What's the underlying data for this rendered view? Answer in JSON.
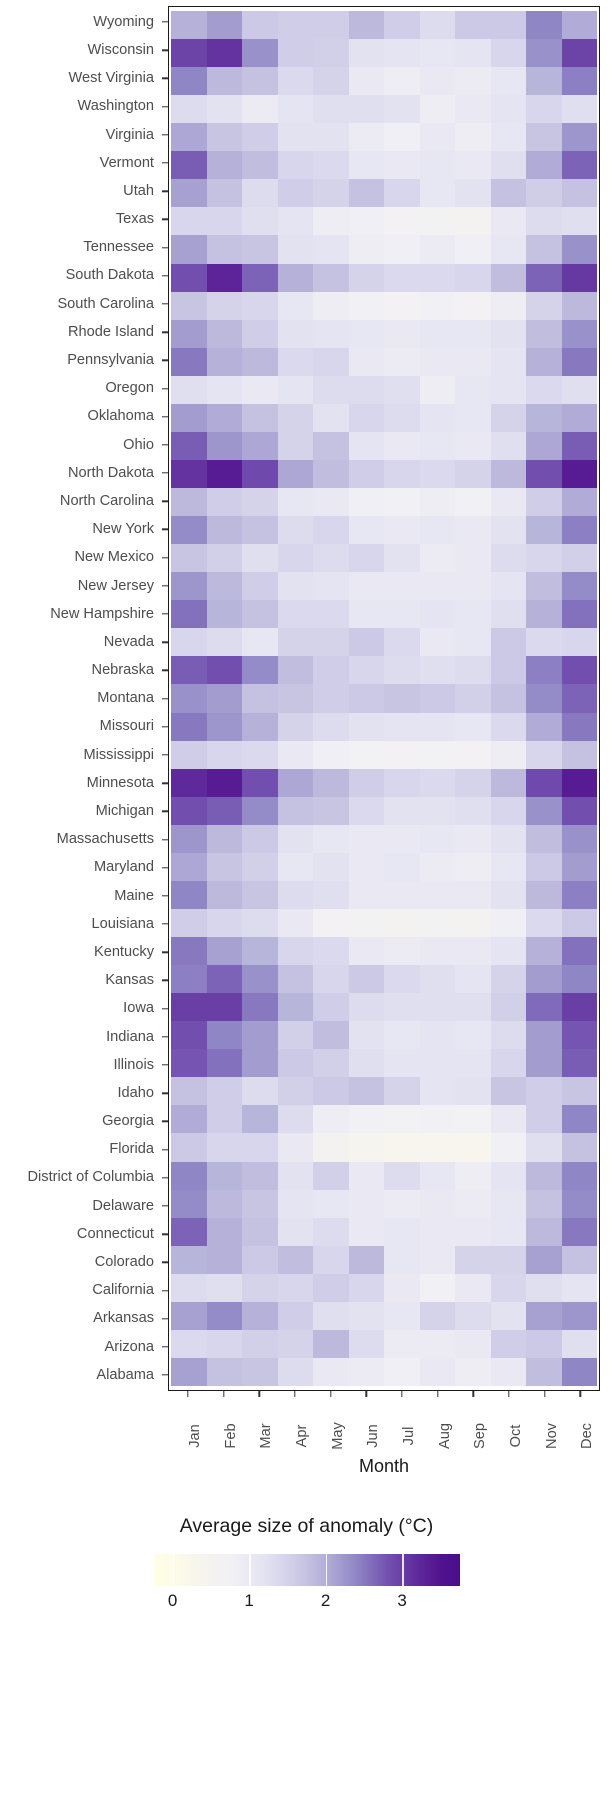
{
  "axes": {
    "x_title": "Month",
    "y_title": ""
  },
  "legend": {
    "title": "Average size of anomaly (°C)",
    "ticks": [
      0,
      1,
      2,
      3
    ],
    "tick_labels": [
      "0",
      "1",
      "2",
      "3"
    ],
    "range": [
      -0.25,
      3.75
    ],
    "gradient_stops": [
      {
        "pos": 0.0,
        "color": "#FFFFE5"
      },
      {
        "pos": 0.07,
        "color": "#FCFBE8"
      },
      {
        "pos": 0.16,
        "color": "#F6F4EE"
      },
      {
        "pos": 0.26,
        "color": "#F1F0F5"
      },
      {
        "pos": 0.36,
        "color": "#E4E3F2"
      },
      {
        "pos": 0.46,
        "color": "#CFCDE7"
      },
      {
        "pos": 0.56,
        "color": "#B3AFD8"
      },
      {
        "pos": 0.66,
        "color": "#9087C6"
      },
      {
        "pos": 0.76,
        "color": "#7453B0"
      },
      {
        "pos": 0.86,
        "color": "#5F2A9B"
      },
      {
        "pos": 0.94,
        "color": "#51128E"
      },
      {
        "pos": 1.0,
        "color": "#4A0E8C"
      }
    ]
  },
  "chart_data": {
    "type": "heatmap",
    "title": "",
    "xlabel": "Month",
    "ylabel": "",
    "colorbar_label": "Average size of anomaly (°C)",
    "vmin": 0,
    "vmax": 3.7,
    "grid": false,
    "legend_position": "bottom",
    "categories": [
      "Jan",
      "Feb",
      "Mar",
      "Apr",
      "May",
      "Jun",
      "Jul",
      "Aug",
      "Sep",
      "Oct",
      "Nov",
      "Dec"
    ],
    "rows": [
      "Wyoming",
      "Wisconsin",
      "West Virginia",
      "Washington",
      "Virginia",
      "Vermont",
      "Utah",
      "Texas",
      "Tennessee",
      "South Dakota",
      "South Carolina",
      "Rhode Island",
      "Pennsylvania",
      "Oregon",
      "Oklahoma",
      "Ohio",
      "North Dakota",
      "North Carolina",
      "New York",
      "New Mexico",
      "New Jersey",
      "New Hampshire",
      "Nevada",
      "Nebraska",
      "Montana",
      "Missouri",
      "Mississippi",
      "Minnesota",
      "Michigan",
      "Massachusetts",
      "Maryland",
      "Maine",
      "Louisiana",
      "Kentucky",
      "Kansas",
      "Iowa",
      "Indiana",
      "Illinois",
      "Idaho",
      "Georgia",
      "Florida",
      "District of Columbia",
      "Delaware",
      "Connecticut",
      "Colorado",
      "California",
      "Arkansas",
      "Arizona",
      "Alabama"
    ],
    "values": [
      [
        2.05,
        2.25,
        1.75,
        1.7,
        1.7,
        1.95,
        1.7,
        1.45,
        1.75,
        1.75,
        2.45,
        2.1
      ],
      [
        2.95,
        3.1,
        2.35,
        1.7,
        1.65,
        1.35,
        1.3,
        1.25,
        1.3,
        1.55,
        2.35,
        2.95
      ],
      [
        2.45,
        1.95,
        1.85,
        1.5,
        1.6,
        1.15,
        1.05,
        1.2,
        1.1,
        1.25,
        2.0,
        2.5
      ],
      [
        1.45,
        1.35,
        1.1,
        1.3,
        1.4,
        1.4,
        1.35,
        1.05,
        1.2,
        1.3,
        1.55,
        1.4
      ],
      [
        2.15,
        1.8,
        1.7,
        1.35,
        1.35,
        1.1,
        1.0,
        1.15,
        1.05,
        1.25,
        1.8,
        2.3
      ],
      [
        2.75,
        2.05,
        1.9,
        1.55,
        1.5,
        1.25,
        1.2,
        1.25,
        1.2,
        1.4,
        2.1,
        2.7
      ],
      [
        2.2,
        1.85,
        1.45,
        1.7,
        1.6,
        1.85,
        1.55,
        1.25,
        1.35,
        1.85,
        1.7,
        1.85
      ],
      [
        1.55,
        1.55,
        1.4,
        1.3,
        1.05,
        1.0,
        0.85,
        0.8,
        0.75,
        1.2,
        1.45,
        1.4
      ],
      [
        2.2,
        1.85,
        1.8,
        1.35,
        1.3,
        1.05,
        1.0,
        1.1,
        1.0,
        1.25,
        1.85,
        2.35
      ],
      [
        2.85,
        3.25,
        2.7,
        2.05,
        1.85,
        1.6,
        1.5,
        1.5,
        1.55,
        1.9,
        2.7,
        3.05
      ],
      [
        1.8,
        1.6,
        1.55,
        1.25,
        1.05,
        0.95,
        0.85,
        0.95,
        0.85,
        1.05,
        1.6,
        1.95
      ],
      [
        2.25,
        1.95,
        1.7,
        1.35,
        1.3,
        1.25,
        1.2,
        1.25,
        1.25,
        1.35,
        1.9,
        2.35
      ],
      [
        2.55,
        2.05,
        1.95,
        1.5,
        1.55,
        1.2,
        1.1,
        1.2,
        1.15,
        1.3,
        2.05,
        2.55
      ],
      [
        1.4,
        1.3,
        1.15,
        1.3,
        1.45,
        1.45,
        1.4,
        1.05,
        1.25,
        1.3,
        1.5,
        1.4
      ],
      [
        2.25,
        2.1,
        1.85,
        1.6,
        1.35,
        1.55,
        1.45,
        1.3,
        1.25,
        1.6,
        2.0,
        2.1
      ],
      [
        2.75,
        2.3,
        2.15,
        1.6,
        1.85,
        1.3,
        1.2,
        1.25,
        1.2,
        1.4,
        2.15,
        2.75
      ],
      [
        3.1,
        3.35,
        2.9,
        2.15,
        1.9,
        1.7,
        1.55,
        1.5,
        1.6,
        1.95,
        2.85,
        3.35
      ],
      [
        1.95,
        1.7,
        1.6,
        1.25,
        1.2,
        1.0,
        0.95,
        1.05,
        0.95,
        1.15,
        1.7,
        2.1
      ],
      [
        2.4,
        1.95,
        1.85,
        1.45,
        1.55,
        1.25,
        1.2,
        1.25,
        1.2,
        1.35,
        2.0,
        2.5
      ],
      [
        1.8,
        1.65,
        1.4,
        1.55,
        1.45,
        1.55,
        1.35,
        1.1,
        1.15,
        1.45,
        1.55,
        1.65
      ],
      [
        2.3,
        1.95,
        1.7,
        1.35,
        1.3,
        1.2,
        1.15,
        1.2,
        1.2,
        1.3,
        1.9,
        2.4
      ],
      [
        2.6,
        2.0,
        1.85,
        1.5,
        1.5,
        1.25,
        1.25,
        1.3,
        1.25,
        1.4,
        2.05,
        2.6
      ],
      [
        1.55,
        1.45,
        1.25,
        1.6,
        1.6,
        1.75,
        1.5,
        1.2,
        1.25,
        1.75,
        1.5,
        1.55
      ],
      [
        2.75,
        2.85,
        2.4,
        1.9,
        1.7,
        1.55,
        1.45,
        1.4,
        1.45,
        1.75,
        2.5,
        2.85
      ],
      [
        2.35,
        2.25,
        1.85,
        1.8,
        1.7,
        1.75,
        1.8,
        1.75,
        1.65,
        1.85,
        2.4,
        2.7
      ],
      [
        2.55,
        2.3,
        2.05,
        1.6,
        1.45,
        1.35,
        1.3,
        1.3,
        1.25,
        1.5,
        2.1,
        2.55
      ],
      [
        1.7,
        1.55,
        1.5,
        1.2,
        1.0,
        0.9,
        0.85,
        0.9,
        0.85,
        1.05,
        1.55,
        1.85
      ],
      [
        3.2,
        3.35,
        2.85,
        2.15,
        1.95,
        1.7,
        1.55,
        1.5,
        1.6,
        1.95,
        2.9,
        3.35
      ],
      [
        2.85,
        2.75,
        2.4,
        1.85,
        1.8,
        1.5,
        1.35,
        1.35,
        1.4,
        1.55,
        2.35,
        2.85
      ],
      [
        2.3,
        1.95,
        1.75,
        1.35,
        1.25,
        1.2,
        1.15,
        1.25,
        1.2,
        1.35,
        1.9,
        2.35
      ],
      [
        2.15,
        1.8,
        1.65,
        1.25,
        1.35,
        1.15,
        1.25,
        1.1,
        1.05,
        1.25,
        1.75,
        2.25
      ],
      [
        2.45,
        1.95,
        1.8,
        1.45,
        1.4,
        1.2,
        1.15,
        1.2,
        1.2,
        1.35,
        1.95,
        2.5
      ],
      [
        1.7,
        1.55,
        1.45,
        1.15,
        0.85,
        0.8,
        0.75,
        0.8,
        0.75,
        1.0,
        1.5,
        1.75
      ],
      [
        2.55,
        2.2,
        2.0,
        1.55,
        1.5,
        1.2,
        1.1,
        1.2,
        1.15,
        1.3,
        2.05,
        2.6
      ],
      [
        2.5,
        2.7,
        2.35,
        1.85,
        1.55,
        1.75,
        1.5,
        1.4,
        1.3,
        1.6,
        2.25,
        2.45
      ],
      [
        3.0,
        3.0,
        2.55,
        2.0,
        1.7,
        1.45,
        1.4,
        1.4,
        1.4,
        1.65,
        2.65,
        3.0
      ],
      [
        2.85,
        2.45,
        2.25,
        1.65,
        1.9,
        1.35,
        1.25,
        1.3,
        1.25,
        1.45,
        2.25,
        2.8
      ],
      [
        2.8,
        2.6,
        2.25,
        1.75,
        1.65,
        1.4,
        1.3,
        1.3,
        1.3,
        1.55,
        2.25,
        2.75
      ],
      [
        1.85,
        1.7,
        1.45,
        1.65,
        1.75,
        1.85,
        1.6,
        1.3,
        1.35,
        1.8,
        1.7,
        1.8
      ],
      [
        2.1,
        1.7,
        2.0,
        1.45,
        1.05,
        0.95,
        0.9,
        0.95,
        0.9,
        1.15,
        1.7,
        2.45
      ],
      [
        1.75,
        1.55,
        1.55,
        1.15,
        0.75,
        0.6,
        0.55,
        0.55,
        0.55,
        0.95,
        1.4,
        1.85
      ],
      [
        2.45,
        2.0,
        1.9,
        1.35,
        1.65,
        1.2,
        1.45,
        1.25,
        1.05,
        1.3,
        1.95,
        2.45
      ],
      [
        2.4,
        1.95,
        1.8,
        1.3,
        1.25,
        1.15,
        1.1,
        1.15,
        1.1,
        1.25,
        1.85,
        2.4
      ],
      [
        2.7,
        2.05,
        1.85,
        1.35,
        1.45,
        1.15,
        1.25,
        1.2,
        1.2,
        1.25,
        1.95,
        2.55
      ],
      [
        2.0,
        2.05,
        1.75,
        1.9,
        1.55,
        1.95,
        1.25,
        1.15,
        1.6,
        1.6,
        2.2,
        1.85
      ],
      [
        1.45,
        1.4,
        1.6,
        1.55,
        1.7,
        1.55,
        1.15,
        0.95,
        1.2,
        1.55,
        1.4,
        1.3
      ],
      [
        2.2,
        2.4,
        2.05,
        1.7,
        1.4,
        1.35,
        1.25,
        1.6,
        1.45,
        1.35,
        2.2,
        2.3
      ],
      [
        1.5,
        1.55,
        1.65,
        1.6,
        1.95,
        1.45,
        1.1,
        1.1,
        1.15,
        1.7,
        1.75,
        1.4
      ],
      [
        2.2,
        1.85,
        1.8,
        1.45,
        1.15,
        1.1,
        1.0,
        1.15,
        1.05,
        1.2,
        1.9,
        2.45
      ]
    ]
  }
}
